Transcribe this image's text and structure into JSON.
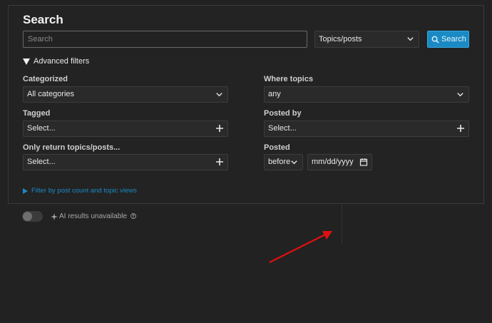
{
  "search": {
    "title": "Search",
    "placeholder": "Search",
    "type_select": "Topics/posts",
    "button_label": "Search"
  },
  "advanced": {
    "toggle_label": "Advanced filters",
    "categorized": {
      "label": "Categorized",
      "value": "All categories"
    },
    "where_topics": {
      "label": "Where topics",
      "value": "any"
    },
    "tagged": {
      "label": "Tagged",
      "value": "Select..."
    },
    "posted_by": {
      "label": "Posted by",
      "value": "Select..."
    },
    "only_return": {
      "label": "Only return topics/posts...",
      "value": "Select..."
    },
    "posted": {
      "label": "Posted",
      "comparator": "before",
      "date_placeholder": "mm/dd/yyyy"
    },
    "post_count_link": "Filter by post count and topic views"
  },
  "ai": {
    "status_text": "AI results unavailable",
    "toggle_on": false
  },
  "colors": {
    "accent": "#1a8ac5",
    "background": "#222222",
    "annotation_arrow": "#e01010"
  },
  "icons": [
    "chevron-down-icon",
    "plus-icon",
    "search-icon",
    "triangle-down-icon",
    "triangle-right-icon",
    "sparkle-icon",
    "question-circle-icon",
    "calendar-icon",
    "annotation-arrow"
  ]
}
